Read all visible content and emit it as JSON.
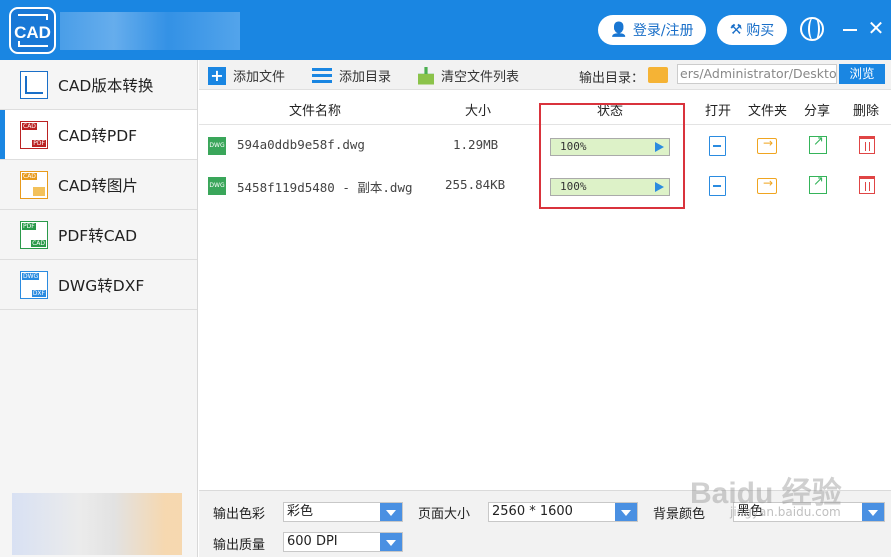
{
  "app": {
    "logo_text": "CAD"
  },
  "header": {
    "login_label": "登录/注册",
    "buy_label": "购买"
  },
  "sidebar": {
    "items": [
      {
        "label": "CAD版本转换",
        "icon": "cad-version-icon",
        "active": false
      },
      {
        "label": "CAD转PDF",
        "icon": "cad-to-pdf-icon",
        "active": true,
        "tags": [
          "CAD",
          "PDF"
        ]
      },
      {
        "label": "CAD转图片",
        "icon": "cad-to-image-icon",
        "active": false,
        "tags": [
          "CAD",
          ""
        ]
      },
      {
        "label": "PDF转CAD",
        "icon": "pdf-to-cad-icon",
        "active": false,
        "tags": [
          "PDF",
          "CAD"
        ]
      },
      {
        "label": "DWG转DXF",
        "icon": "dwg-to-dxf-icon",
        "active": false,
        "tags": [
          "DWG",
          "DXF"
        ]
      }
    ]
  },
  "toolbar": {
    "add_file": "添加文件",
    "add_dir": "添加目录",
    "clear_list": "清空文件列表",
    "output_dir_label": "输出目录：",
    "output_path": "ers/Administrator/Desktop",
    "browse": "浏览"
  },
  "table": {
    "headers": {
      "name": "文件名称",
      "size": "大小",
      "status": "状态",
      "open": "打开",
      "folder": "文件夹",
      "share": "分享",
      "delete": "删除"
    },
    "rows": [
      {
        "file_type": "DWG",
        "name": "594a0ddb9e58f.dwg",
        "size": "1.29MB",
        "progress_text": "100%",
        "progress": 1.0
      },
      {
        "file_type": "DWG",
        "name": "5458f119d5480 - 副本.dwg",
        "size": "255.84KB",
        "progress_text": "100%",
        "progress": 1.0
      }
    ]
  },
  "settings": {
    "color_label": "输出色彩",
    "color_value": "彩色",
    "page_size_label": "页面大小",
    "page_size_value": "2560 * 1600",
    "bg_color_label": "背景颜色",
    "bg_color_value": "黑色",
    "quality_label": "输出质量",
    "quality_value": "600 DPI"
  },
  "watermark": {
    "brand": "Baidu 经验",
    "url": "jingyan.baidu.com"
  },
  "colors": {
    "primary": "#1a86e2",
    "highlight": "#d9333c",
    "progress_fill": "#ddf2c8"
  }
}
